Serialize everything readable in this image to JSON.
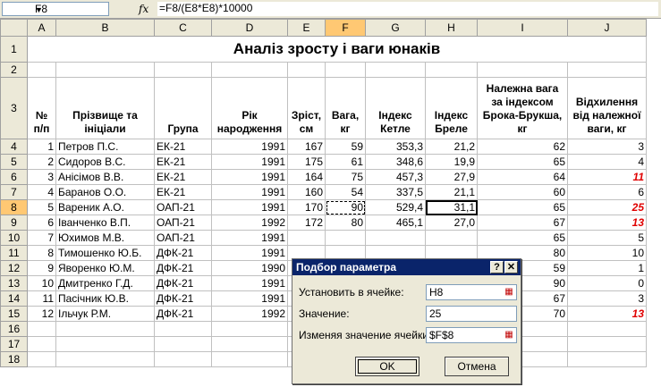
{
  "formula_bar": {
    "name_box": "F8",
    "fx_label": "fx",
    "formula": "=F8/(E8*E8)*10000"
  },
  "columns": [
    "A",
    "B",
    "C",
    "D",
    "E",
    "F",
    "G",
    "H",
    "I",
    "J"
  ],
  "row_numbers": [
    "1",
    "2",
    "3",
    "4",
    "5",
    "6",
    "7",
    "8",
    "9",
    "10",
    "11",
    "12",
    "13",
    "14",
    "15",
    "16",
    "17",
    "18"
  ],
  "sheet": {
    "title": "Аналіз зросту і ваги юнаків",
    "headers": {
      "no": "№ п/п",
      "name": "Прізвище та ініціали",
      "group": "Група",
      "year": "Рік народження",
      "height": "Зріст, см",
      "weight": "Вага, кг",
      "quetelet": "Індекс Кетле",
      "breal": "Індекс Бреле",
      "broca": "Належна вага за індексом Брока-Брукша, кг",
      "deviation": "Відхилення від належної ваги, кг"
    },
    "rows": [
      [
        "1",
        "Петров П.С.",
        "ЕК-21",
        "1991",
        "167",
        "59",
        "353,3",
        "21,2",
        "62",
        "3"
      ],
      [
        "2",
        "Сидоров В.С.",
        "ЕК-21",
        "1991",
        "175",
        "61",
        "348,6",
        "19,9",
        "65",
        "4"
      ],
      [
        "3",
        "Анісімов В.В.",
        "ЕК-21",
        "1991",
        "164",
        "75",
        "457,3",
        "27,9",
        "64",
        "11"
      ],
      [
        "4",
        "Баранов О.О.",
        "ЕК-21",
        "1991",
        "160",
        "54",
        "337,5",
        "21,1",
        "60",
        "6"
      ],
      [
        "5",
        "Вареник А.О.",
        "ОАП-21",
        "1991",
        "170",
        "90",
        "529,4",
        "31,1",
        "65",
        "25"
      ],
      [
        "6",
        "Іванченко В.П.",
        "ОАП-21",
        "1992",
        "172",
        "80",
        "465,1",
        "27,0",
        "67",
        "13"
      ],
      [
        "7",
        "Юхимов М.В.",
        "ОАП-21",
        "1991",
        "",
        "",
        "",
        "",
        "65",
        "5"
      ],
      [
        "8",
        "Тимошенко Ю.Б.",
        "ДФК-21",
        "1991",
        "",
        "",
        "",
        "",
        "80",
        "10"
      ],
      [
        "9",
        "Яворенко Ю.М.",
        "ДФК-21",
        "1990",
        "",
        "",
        "",
        "",
        "59",
        "1"
      ],
      [
        "10",
        "Дмитренко Г.Д.",
        "ДФК-21",
        "1991",
        "",
        "",
        "",
        "",
        "90",
        "0"
      ],
      [
        "11",
        "Пасічник Ю.В.",
        "ДФК-21",
        "1991",
        "",
        "",
        "",
        "",
        "67",
        "3"
      ],
      [
        "12",
        "Ільчук Р.М.",
        "ДФК-21",
        "1992",
        "",
        "",
        "",
        "",
        "70",
        "13"
      ]
    ],
    "red_deviation_rows": [
      2,
      4,
      5,
      11
    ]
  },
  "dialog": {
    "title": "Подбор параметра",
    "help_btn": "?",
    "close_btn": "✕",
    "set_cell_label": "Установить в ячейке:",
    "set_cell_value": "H8",
    "value_label": "Значение:",
    "value_value": "25",
    "change_cell_label": "Изменяя значение ячейки:",
    "change_cell_value": "$F$8",
    "ok": "OK",
    "cancel": "Отмена"
  },
  "colors": {
    "header_bg": "#ece9d8",
    "selected_header": "#ffc873",
    "title_bar": "#0a246a",
    "red_value": "#e00000"
  }
}
